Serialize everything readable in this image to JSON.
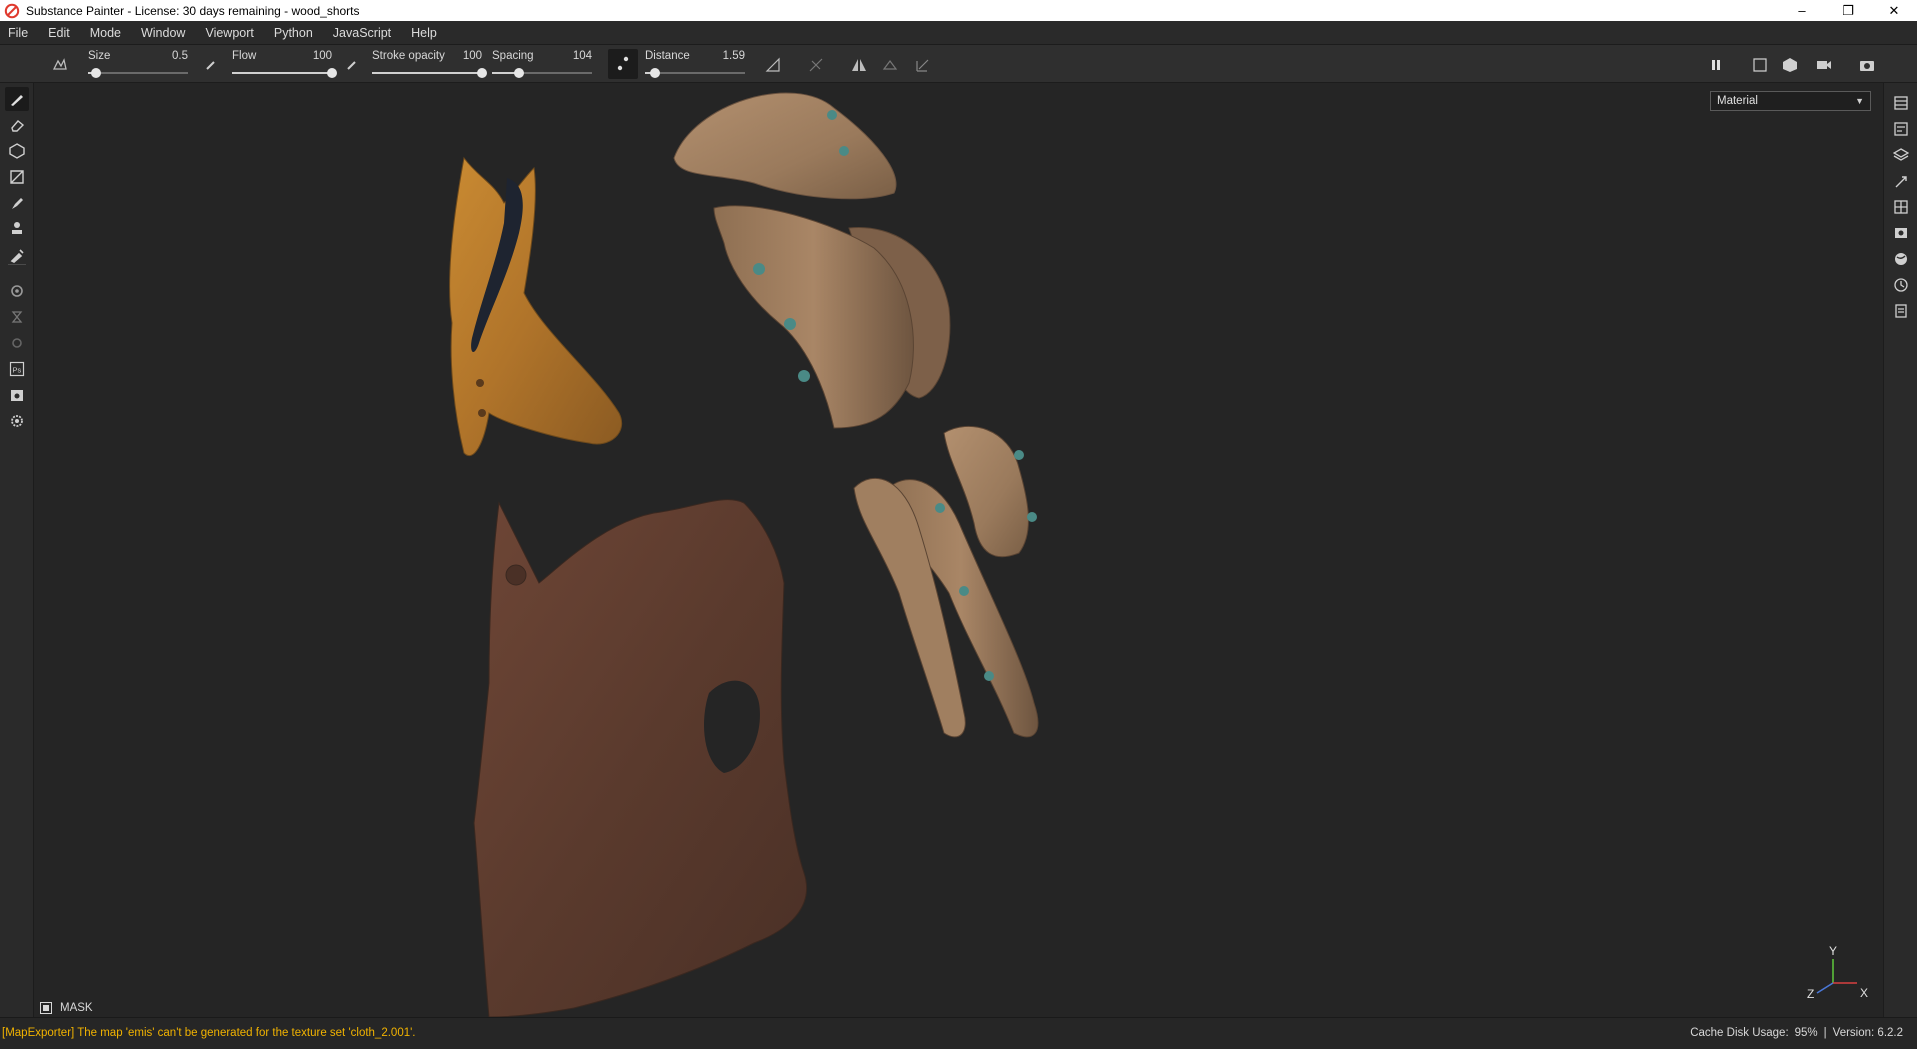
{
  "window": {
    "title": "Substance Painter - License: 30 days remaining - wood_shorts",
    "controls": [
      "–",
      "❐",
      "✕"
    ]
  },
  "menu": [
    "File",
    "Edit",
    "Mode",
    "Window",
    "Viewport",
    "Python",
    "JavaScript",
    "Help"
  ],
  "tool_options": {
    "size": {
      "label": "Size",
      "value": "0.5",
      "level": 0.08
    },
    "flow": {
      "label": "Flow",
      "value": "100",
      "level": 1.0
    },
    "stroke_opacity": {
      "label": "Stroke opacity",
      "value": "100",
      "level": 1.0
    },
    "spacing": {
      "label": "Spacing",
      "value": "104",
      "level": 0.27
    },
    "distance": {
      "label": "Distance",
      "value": "1.59",
      "level": 0.1
    }
  },
  "left_tools": [
    "paint-brush-icon",
    "eraser-icon",
    "projection-icon",
    "polygon-fill-icon",
    "smudge-icon",
    "clone-stamp-icon",
    "color-picker-icon",
    "plugin-settings-icon",
    "hourglass-icon",
    "plugin-icon",
    "photoshop-export-icon",
    "screenshot-icon",
    "gear-icon"
  ],
  "right_tools": [
    "texture-set-list-icon",
    "texture-set-settings-icon",
    "layers-icon",
    "properties-icon",
    "uv-grid-icon",
    "display-settings-icon",
    "environment-icon",
    "history-icon",
    "log-icon"
  ],
  "viewport": {
    "channel_select": "Material",
    "mask_label": "MASK",
    "axis_labels": {
      "y": "Y",
      "z": "Z",
      "x": "X"
    },
    "colors": {
      "y": "#5cbf3a",
      "x": "#d84040",
      "z": "#4a78d8"
    }
  },
  "status": {
    "message": "[MapExporter] The map 'emis' can't be generated for the texture set 'cloth_2.001'.",
    "cache_label": "Cache Disk Usage:",
    "cache_value": "95%",
    "separator": "|",
    "version": "Version: 6.2.2"
  },
  "colors": {
    "warning": "#f2b300",
    "background": "#252525",
    "panel": "#2a2a2a"
  }
}
